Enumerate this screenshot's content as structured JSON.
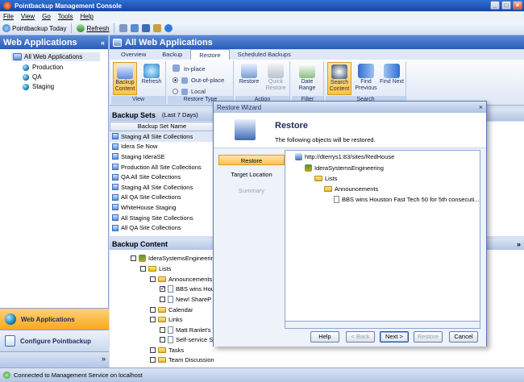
{
  "window": {
    "title": "Pointbackup Management Console"
  },
  "menu": [
    "File",
    "View",
    "Go",
    "Tools",
    "Help"
  ],
  "toolbar": {
    "today": "Pointbackup Today",
    "refresh": "Refresh"
  },
  "left": {
    "header": "Web Applications",
    "root": "All Web Applications",
    "items": [
      "Production",
      "QA",
      "Staging"
    ],
    "nav_web": "Web Applications",
    "nav_configure": "Configure Pointbackup"
  },
  "right": {
    "header": "All Web Applications",
    "tabs": [
      "Overview",
      "Backup",
      "Restore",
      "Scheduled Backups"
    ],
    "ribbon": {
      "view": {
        "backup_content": "Backup Content",
        "refresh": "Refresh",
        "label": "View"
      },
      "restore_type": {
        "in_place": "In-place",
        "out_of_place": "Out-of-place",
        "local": "Local",
        "label": "Restore Type"
      },
      "action": {
        "restore": "Restore",
        "quick_restore": "Quick Restore",
        "label": "Action"
      },
      "filter": {
        "date_range": "Date Range",
        "label": "Filter"
      },
      "search": {
        "search_content": "Search Content",
        "find_previous": "Find Previous",
        "find_next": "Find Next",
        "label": "Search"
      }
    },
    "backup_sets": {
      "title": "Backup Sets",
      "subtitle": "(Last 7 Days)",
      "column": "Backup Set Name",
      "rows": [
        "Staging All Site Collections",
        "Idera Se Now",
        "Staging IderaSE",
        "Production All Site Collections",
        "QA All Site Collections",
        "Staging All Site Collections",
        "All QA Site Collections",
        "WhiteHouse Staging",
        "All Staging Site Collections",
        "All QA Site Collections"
      ]
    },
    "backup_content": {
      "title": "Backup Content",
      "nodes": [
        "IderaSystemsEngineering",
        "Lists",
        "Announcements",
        "BBS wins Hou",
        "New! ShareP",
        "Calendar",
        "Links",
        "Matt Ranlet's",
        "Self-service S",
        "Tasks",
        "Team Discussion"
      ]
    }
  },
  "status": "Connected to Management Service on localhost",
  "dialog": {
    "title": "Restore Wizard",
    "heading": "Restore",
    "description": "The following objects will be restored.",
    "steps": [
      "Restore",
      "Target Location",
      "Summary"
    ],
    "objects": [
      "http://dterrys1:83/sites/RedHouse",
      "IderaSystemsEngineering",
      "Lists",
      "Announcements",
      "BBS wins Houston Fast Tech 50 for 5th consecuti..."
    ],
    "buttons": {
      "help": "Help",
      "back": "< Back",
      "next": "Next >",
      "restore": "Restore",
      "cancel": "Cancel"
    }
  },
  "colors": {
    "accent": "#2b5cb8",
    "highlight": "#ffc34d"
  }
}
